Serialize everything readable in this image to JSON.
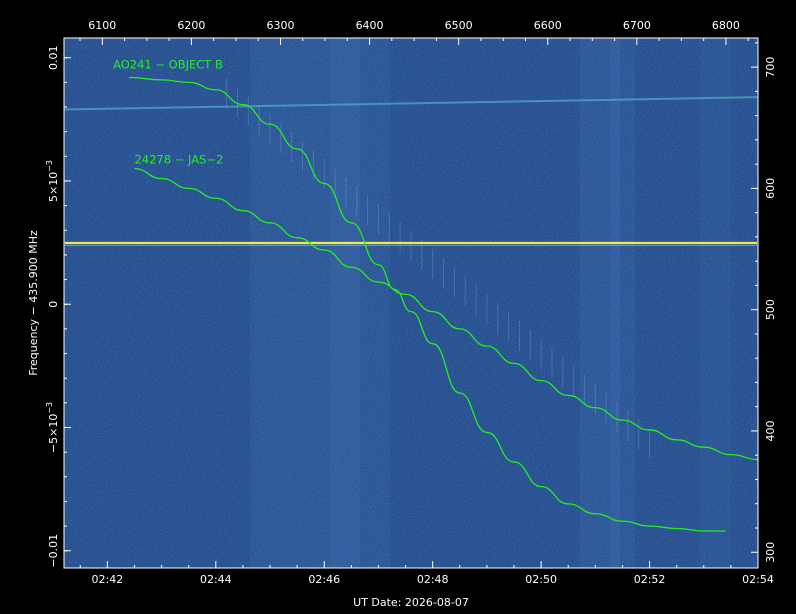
{
  "chart_data": {
    "type": "spectrogram",
    "xlabel": "UT Date: 2026-08-07",
    "ylabel": "Frequency − 435.900 MHz",
    "x_ticks": [
      "02:42",
      "02:44",
      "02:46",
      "02:48",
      "02:50",
      "02:52",
      "02:54"
    ],
    "x_minutes": [
      42,
      44,
      46,
      48,
      50,
      52,
      54
    ],
    "xlim_minutes": [
      41.2,
      54.0
    ],
    "top_ticks": [
      6100,
      6200,
      6300,
      6400,
      6500,
      6600,
      6700,
      6800
    ],
    "top_xlim": [
      6057,
      6836
    ],
    "y_ticks": [
      {
        "value": 0.01,
        "label": "0.01"
      },
      {
        "value": 0.005,
        "label": "5×10",
        "sup": "−3"
      },
      {
        "value": 0,
        "label": "0"
      },
      {
        "value": -0.005,
        "label": "−5×10",
        "sup": "−3"
      },
      {
        "value": -0.01,
        "label": "−0.01"
      }
    ],
    "ylim": [
      -0.0107,
      0.0108
    ],
    "right_ticks": [
      300,
      400,
      500,
      600,
      700
    ],
    "right_ylim": [
      287,
      724
    ],
    "tracks": [
      {
        "label": "AO241 − OBJECT B",
        "color": "#22ee22",
        "x_minutes": [
          42.4,
          43.0,
          43.5,
          44.0,
          44.5,
          45.0,
          45.5,
          46.0,
          46.5,
          47.0,
          47.3,
          47.6,
          48.0,
          48.5,
          49.0,
          49.5,
          50.0,
          50.5,
          51.0,
          51.5,
          52.0,
          52.5,
          53.0,
          53.4
        ],
        "y": [
          0.0092,
          0.0091,
          0.009,
          0.0087,
          0.0081,
          0.0073,
          0.0063,
          0.0049,
          0.0033,
          0.0016,
          0.0006,
          -0.0003,
          -0.0016,
          -0.0036,
          -0.0052,
          -0.0064,
          -0.0074,
          -0.0081,
          -0.0085,
          -0.0088,
          -0.009,
          -0.0091,
          -0.0092,
          -0.0092
        ]
      },
      {
        "label": "24278 − JAS−2",
        "color": "#22ee22",
        "x_minutes": [
          42.5,
          43.0,
          43.5,
          44.0,
          44.5,
          45.0,
          45.5,
          46.0,
          46.5,
          47.0,
          47.5,
          48.0,
          48.5,
          49.0,
          49.5,
          50.0,
          50.5,
          51.0,
          51.5,
          52.0,
          52.5,
          53.0,
          53.5,
          54.0
        ],
        "y": [
          0.0055,
          0.0051,
          0.0047,
          0.0043,
          0.0038,
          0.0033,
          0.0027,
          0.0022,
          0.0015,
          0.0009,
          0.0004,
          -0.0003,
          -0.001,
          -0.0017,
          -0.0024,
          -0.0031,
          -0.0037,
          -0.0042,
          -0.0047,
          -0.0051,
          -0.0055,
          -0.0058,
          -0.0061,
          -0.0063
        ]
      }
    ],
    "colors": {
      "background": "#1d3f80",
      "carrier": "#f0ee40",
      "axes": "#ffffff",
      "track": "#22ee22"
    }
  }
}
